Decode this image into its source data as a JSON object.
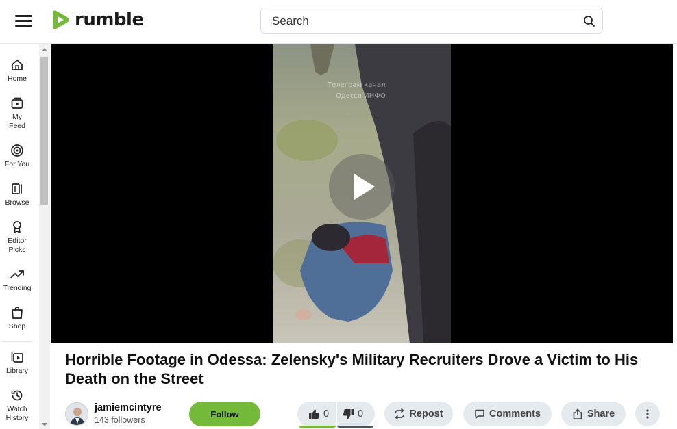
{
  "header": {
    "logo_text": "rumble",
    "search_placeholder": "Search"
  },
  "sidebar": {
    "items": [
      {
        "label": "Home",
        "icon": "home-icon"
      },
      {
        "label": "My Feed",
        "icon": "feed-icon"
      },
      {
        "label": "For You",
        "icon": "target-icon"
      },
      {
        "label": "Browse",
        "icon": "browse-icon"
      },
      {
        "label": "Editor Picks",
        "icon": "award-icon"
      },
      {
        "label": "Trending",
        "icon": "trending-icon"
      },
      {
        "label": "Shop",
        "icon": "shopping-bag-icon"
      },
      {
        "label": "Library",
        "icon": "library-icon"
      },
      {
        "label": "Watch History",
        "icon": "history-icon"
      }
    ]
  },
  "video": {
    "title": "Horrible Footage in Odessa: Zelensky's Military Recruiters Drove a Victim to His Death on the Street",
    "watermark_line1": "Телеграм канал",
    "watermark_line2": "Одесса ИНФО"
  },
  "channel": {
    "name": "jamiemcintyre",
    "followers": "143 followers",
    "follow_label": "Follow"
  },
  "actions": {
    "likes": "0",
    "dislikes": "0",
    "repost_label": "Repost",
    "comments_label": "Comments",
    "share_label": "Share"
  },
  "colors": {
    "brand_green": "#74b93a",
    "button_bg": "#e5eaef",
    "player_bg": "#000000"
  }
}
